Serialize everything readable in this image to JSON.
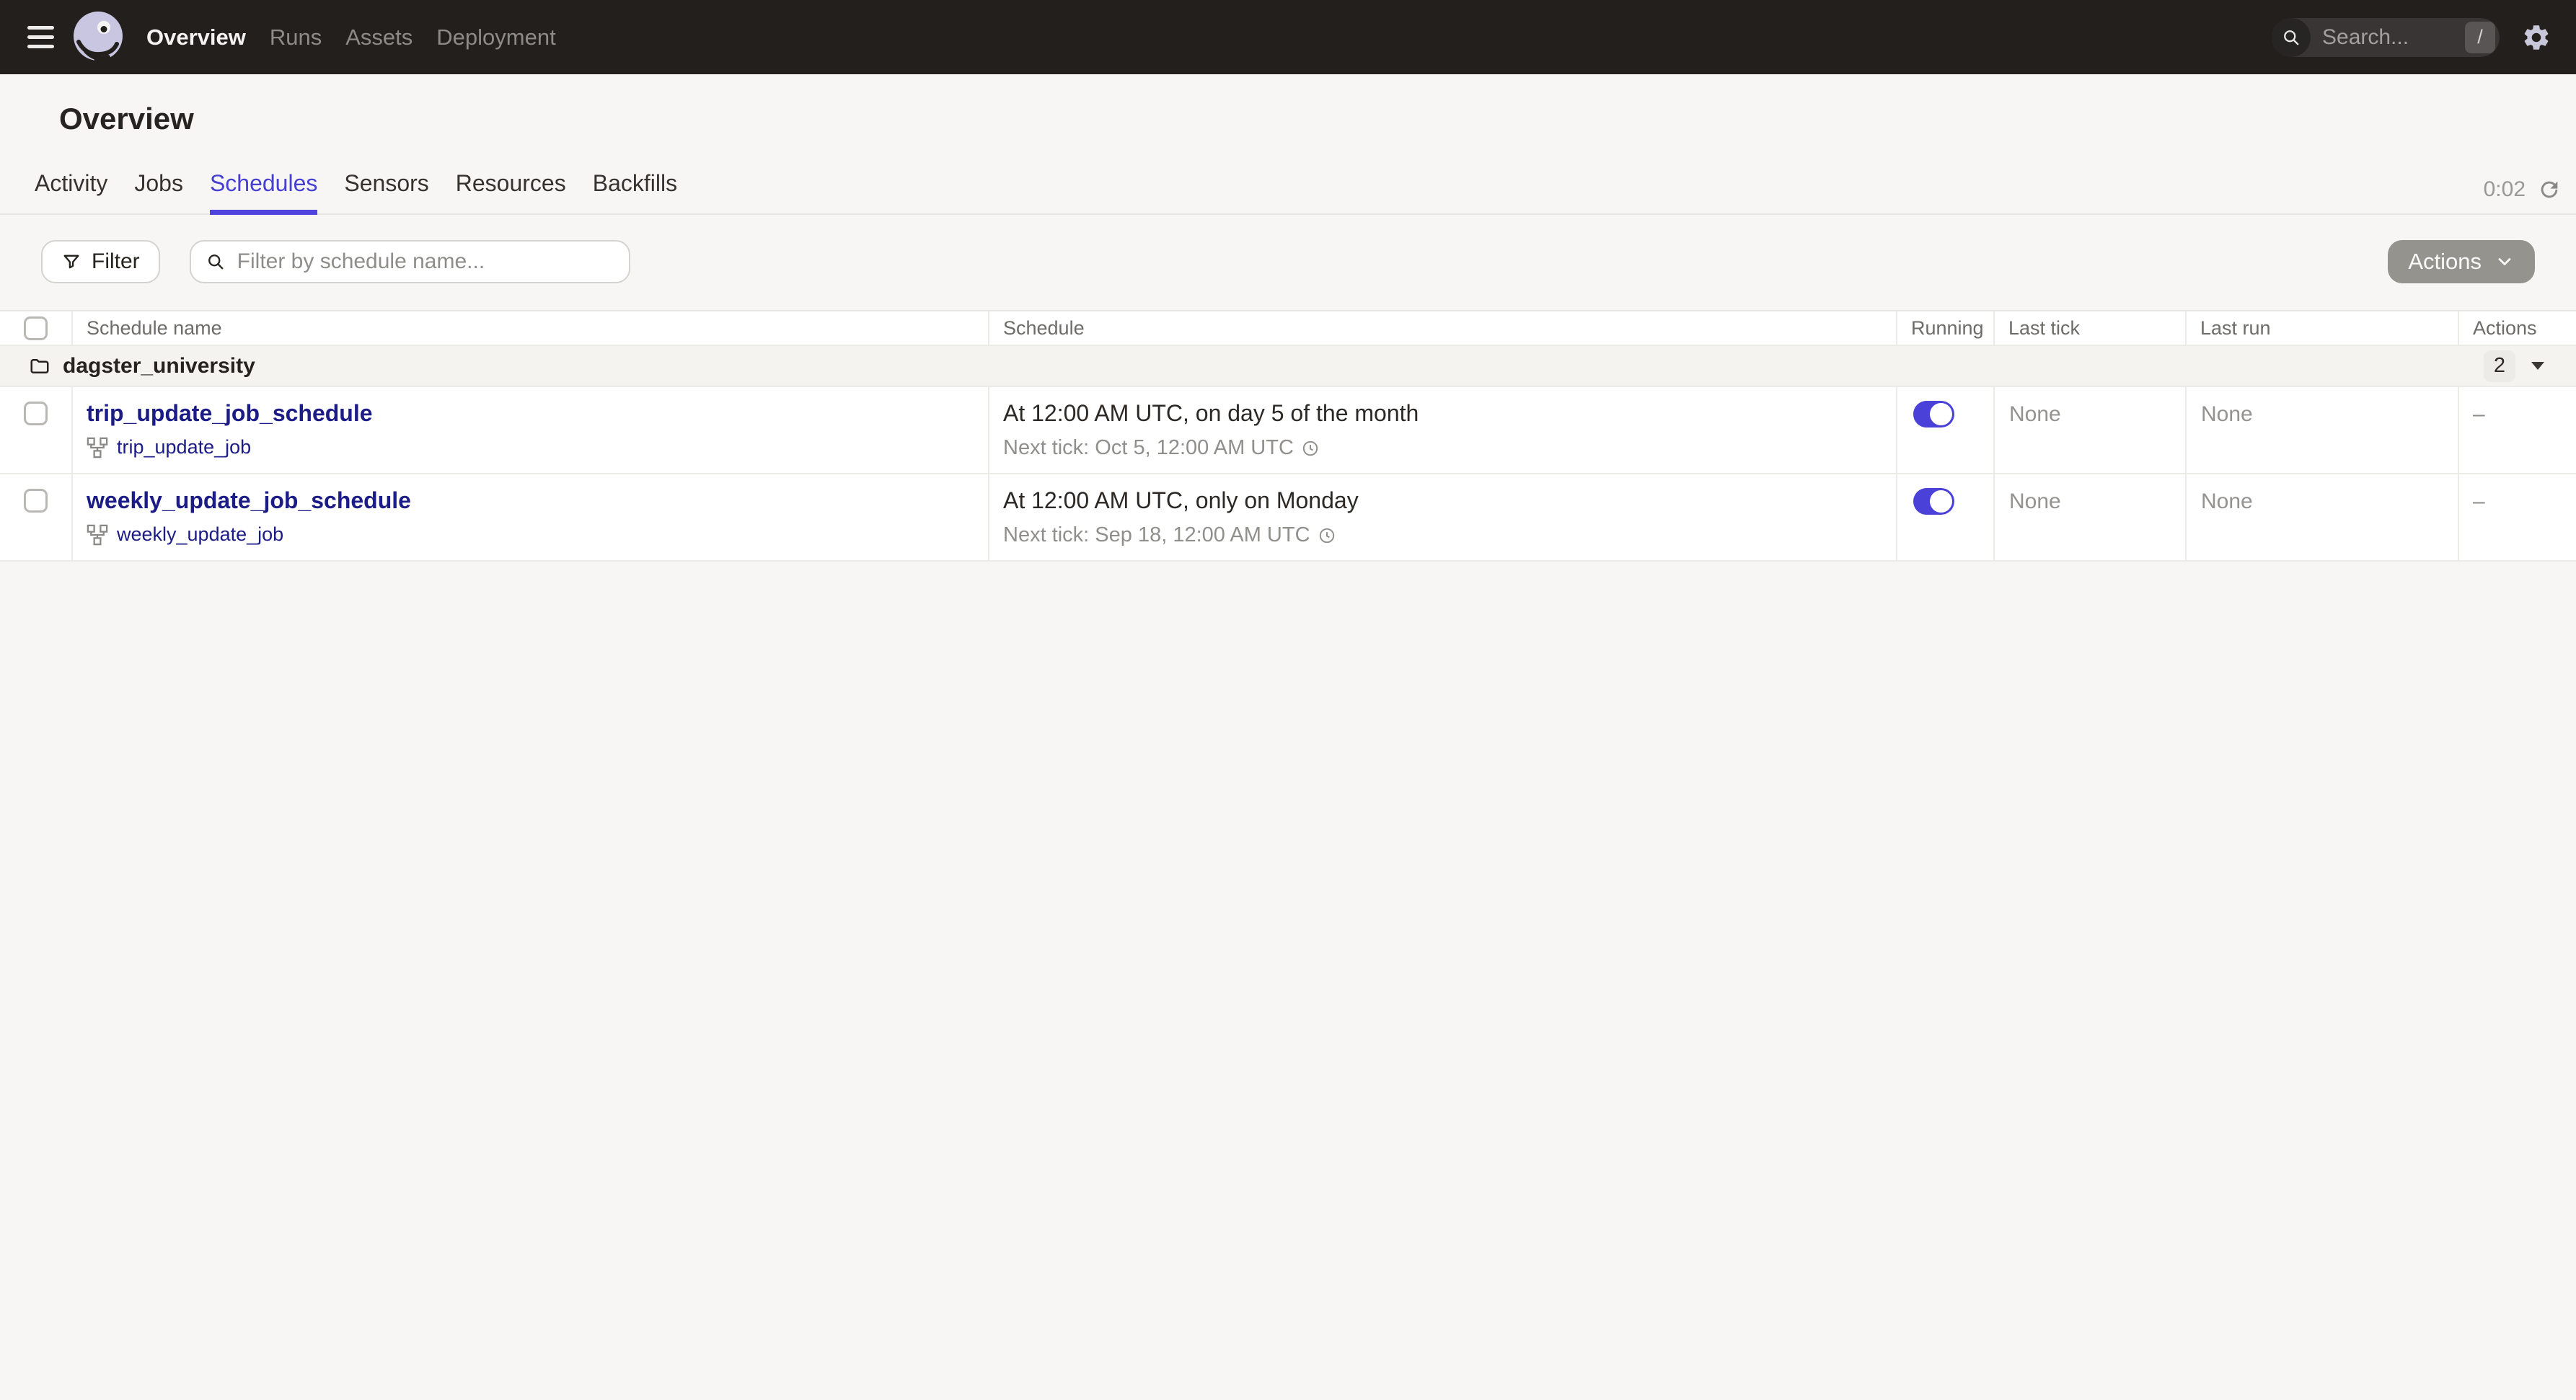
{
  "colors": {
    "accent": "#4f43dd",
    "link": "#1c1c87",
    "header_bg": "#231f1d",
    "toggle_on": "#4a41d8",
    "actions_button_bg": "#95938e",
    "page_bg": "#f7f6f4"
  },
  "header": {
    "nav": [
      {
        "label": "Overview",
        "active": true
      },
      {
        "label": "Runs",
        "active": false
      },
      {
        "label": "Assets",
        "active": false
      },
      {
        "label": "Deployment",
        "active": false
      }
    ],
    "search": {
      "placeholder": "Search...",
      "shortcut_key": "/"
    }
  },
  "page": {
    "title": "Overview",
    "tabs": [
      {
        "label": "Activity",
        "active": false
      },
      {
        "label": "Jobs",
        "active": false
      },
      {
        "label": "Schedules",
        "active": true
      },
      {
        "label": "Sensors",
        "active": false
      },
      {
        "label": "Resources",
        "active": false
      },
      {
        "label": "Backfills",
        "active": false
      }
    ],
    "refresh_timer": "0:02"
  },
  "toolbar": {
    "filter_label": "Filter",
    "filter_placeholder": "Filter by schedule name...",
    "actions_label": "Actions"
  },
  "table": {
    "columns": [
      "Schedule name",
      "Schedule",
      "Running",
      "Last tick",
      "Last run",
      "Actions"
    ],
    "group": {
      "name": "dagster_university",
      "count": "2"
    },
    "rows": [
      {
        "name": "trip_update_job_schedule",
        "job": "trip_update_job",
        "schedule": "At 12:00 AM UTC, on day 5 of the month",
        "next_tick": "Next tick: Oct 5, 12:00 AM UTC",
        "running": true,
        "last_tick": "None",
        "last_run": "None",
        "actions": "–"
      },
      {
        "name": "weekly_update_job_schedule",
        "job": "weekly_update_job",
        "schedule": "At 12:00 AM UTC, only on Monday",
        "next_tick": "Next tick: Sep 18, 12:00 AM UTC",
        "running": true,
        "last_tick": "None",
        "last_run": "None",
        "actions": "–"
      }
    ]
  }
}
